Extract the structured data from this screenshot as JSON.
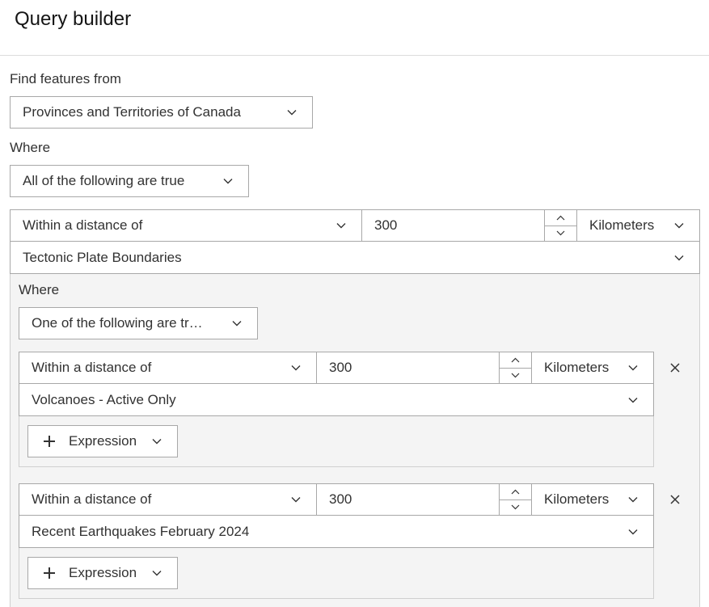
{
  "title": "Query builder",
  "find_features_label": "Find features from",
  "layer_select": "Provinces and Territories of Canada",
  "where_label": "Where",
  "match_select": "All of the following are true",
  "condition1": {
    "operator": "Within a distance of",
    "distance": "300",
    "units": "Kilometers",
    "layer": "Tectonic Plate Boundaries",
    "where_label": "Where",
    "match_select": "One of the following are tr…",
    "sub1": {
      "operator": "Within a distance of",
      "distance": "300",
      "units": "Kilometers",
      "layer": "Volcanoes - Active Only",
      "add_label": "Expression"
    },
    "sub2": {
      "operator": "Within a distance of",
      "distance": "300",
      "units": "Kilometers",
      "layer": "Recent Earthquakes February 2024",
      "add_label": "Expression"
    }
  },
  "icons": {
    "chevron": "chevron-down-icon",
    "stepper_up": "chevron-up-icon",
    "stepper_down": "chevron-down-icon",
    "remove": "close-icon",
    "add": "plus-icon"
  }
}
